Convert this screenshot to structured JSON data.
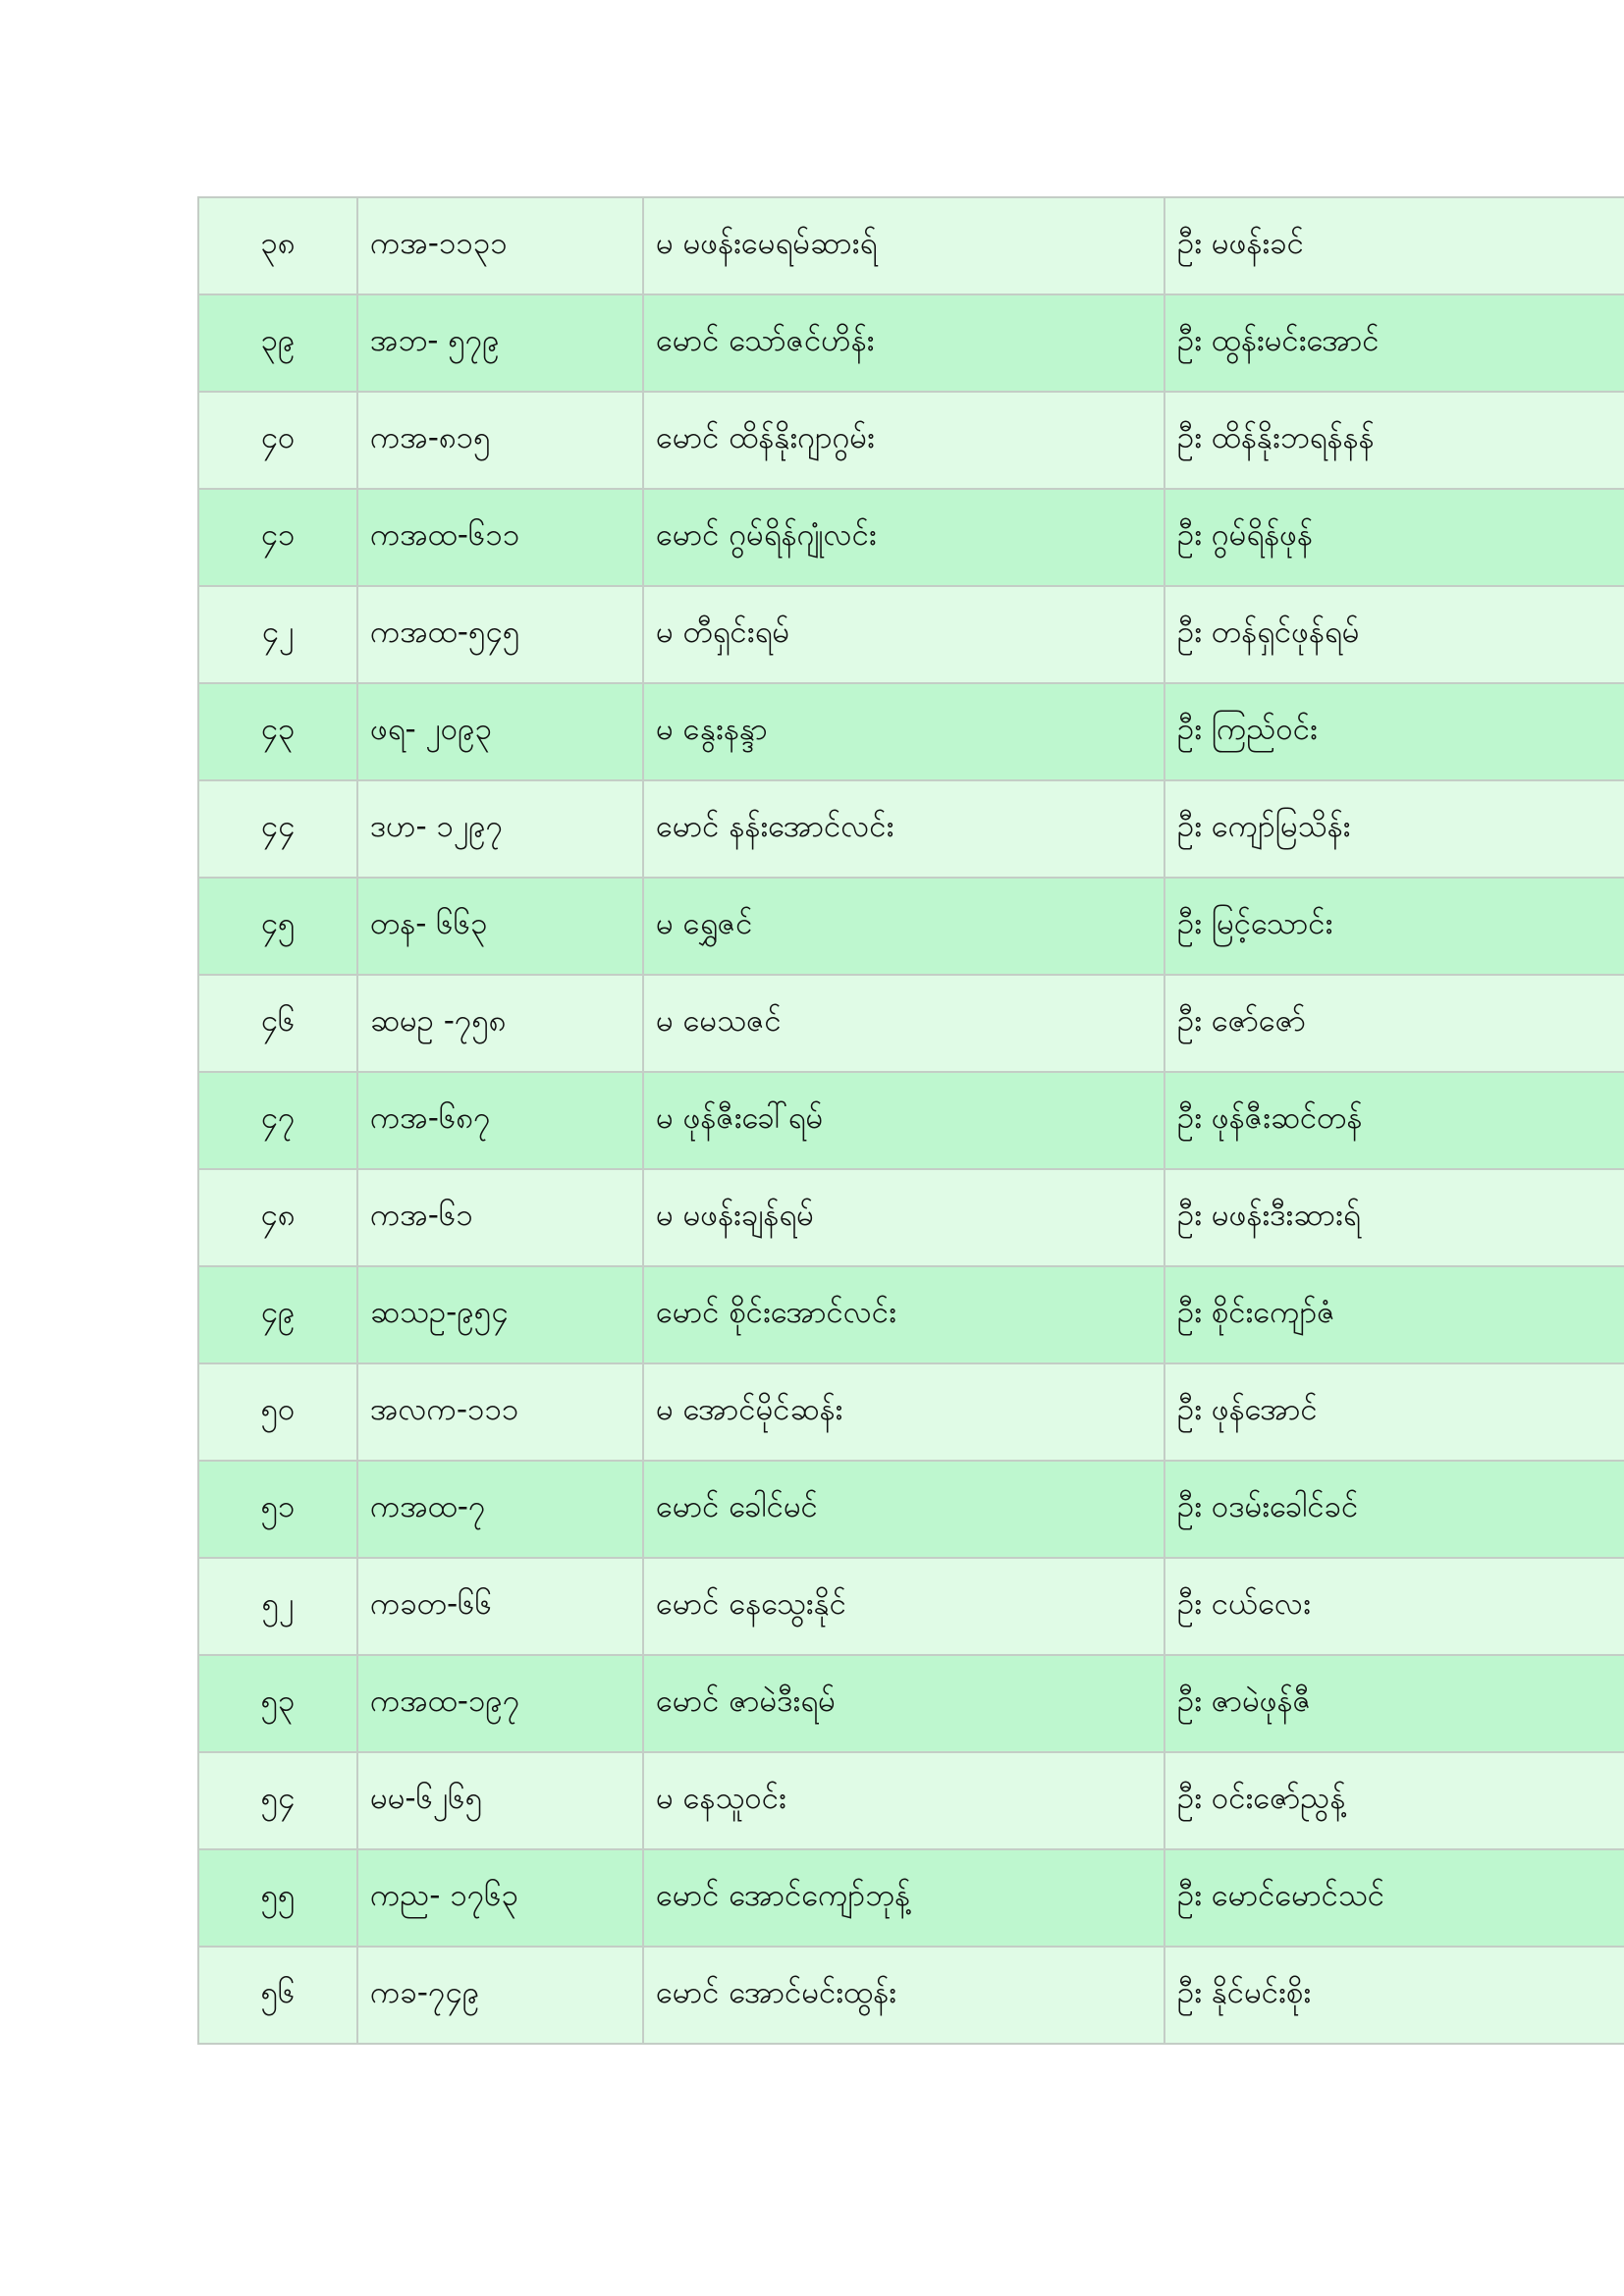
{
  "colors": {
    "row_light": "#e0fbe6",
    "row_dark": "#bef7cf",
    "grid": "#c4cdc6"
  },
  "rows": [
    [
      "၃၈",
      "ကအ-၁၁၃၁",
      "မ မဖန်းမေရမ်ဆားရ်",
      "ဦး မဖန်းခင်"
    ],
    [
      "၃၉",
      "အဘ- ၅၇၉",
      "မောင် သော်ဇင်ဟိန်း",
      "ဦး ထွန်းမင်းအောင်"
    ],
    [
      "၄၀",
      "ကအ-၈၁၅",
      "မောင် ထိန်နိုးဂျာဂွမ်း",
      "ဦး ထိန်နိုးဘရန်နန်"
    ],
    [
      "၄၁",
      "ကအထ-၆၁၁",
      "မောင် ဂွမ်ရိန်ဂျုံလင်း",
      "ဦး ဂွမ်ရိန်ဖုန်"
    ],
    [
      "၄၂",
      "ကအထ-၅၄၅",
      "မ တီရှင်းရမ်",
      "ဦး တန်ရှင်ဖုန်ရမ်"
    ],
    [
      "၄၃",
      "ဖရ- ၂၀၉၃",
      "မ နွေးနန္ဒာ",
      "ဦး ကြည်ဝင်း"
    ],
    [
      "၄၄",
      "ဒဟ- ၁၂၉၇",
      "မောင် နန်းအောင်လင်း",
      "ဦး ကျော်မြသိန်း"
    ],
    [
      "၄၅",
      "တန- ၆၆၃",
      "မ ရွှေဇင်",
      "ဦး မြင့်သောင်း"
    ],
    [
      "၄၆",
      "ဆမဥ -၇၅၈",
      "မ မေသဇင်",
      "ဦး ဇော်ဇော်"
    ],
    [
      "၄၇",
      "ကအ-၆၈၇",
      "မ ဖုန်ဇီးခေါ်ရမ်",
      "ဦး ဖုန်ဇီးဆင်တန်"
    ],
    [
      "၄၈",
      "ကအ-၆၁",
      "မ မဖန်းချန်ရမ်",
      "ဦး မဖန်းဒီးဆားရ်"
    ],
    [
      "၄၉",
      "ဆသဥ-၉၅၄",
      "မောင် စိုင်းအောင်လင်း",
      "ဦး စိုင်းကျော်ဇံ"
    ],
    [
      "၅၀",
      "အလက-၁၁၁",
      "မ အောင်မိုင်ဆန်း",
      "ဦး ဖုန်အောင်"
    ],
    [
      "၅၁",
      "ကအထ-၇",
      "မောင် ခေါင်မင်",
      "ဦး ဝဒမ်းခေါင်ခင်"
    ],
    [
      "၅၂",
      "ကခတ-၆၆",
      "မောင် နေသွေးနိုင်",
      "ဦး ငယ်လေး"
    ],
    [
      "၅၃",
      "ကအထ-၁၉၇",
      "မောင် ဇာမဲဒီးရမ်",
      "ဦး ဇာမဲဖုန်ဇီ"
    ],
    [
      "၅၄",
      "မမ-၆၂၆၅",
      "မ နေသူဝင်း",
      "ဦး ဝင်းဇော်ညွန့်"
    ],
    [
      "၅၅",
      "ကည- ၁၇၆၃",
      "မောင် အောင်ကျော်ဘုန့်",
      "ဦး မောင်မောင်သင်"
    ],
    [
      "၅၆",
      "ကခ-၇၄၉",
      "မောင် အောင်မင်းထွန်း",
      "ဦး နိုင်မင်းစိုး"
    ]
  ]
}
